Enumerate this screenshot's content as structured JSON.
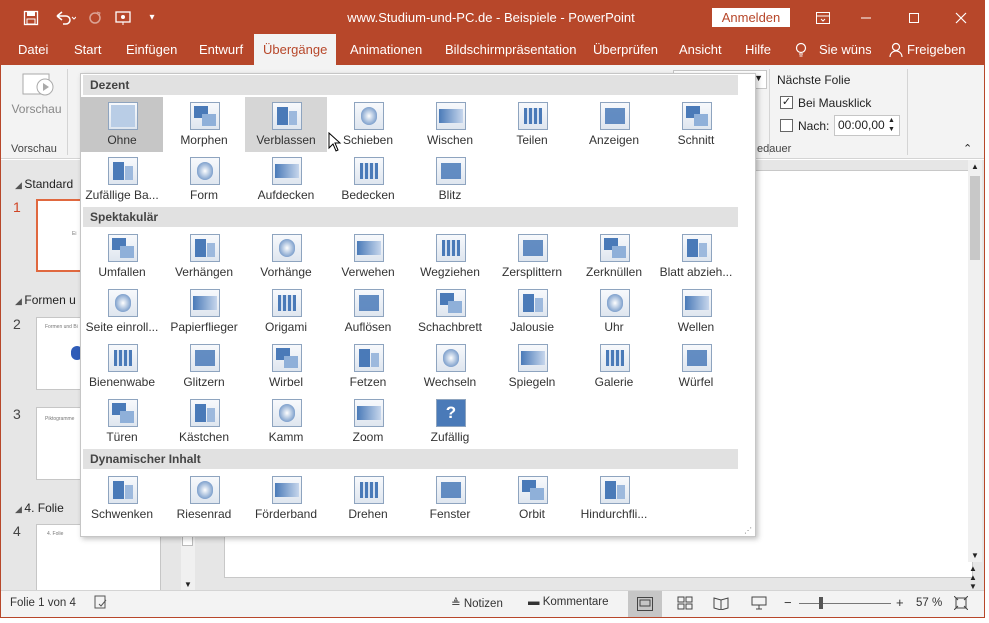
{
  "title": {
    "doc": "www.Studium-und-PC.de - Beispiele - PowerPoint",
    "signin": "Anmelden"
  },
  "tabs": [
    "Datei",
    "Start",
    "Einfügen",
    "Entwurf",
    "Übergänge",
    "Animationen",
    "Bildschirmpräsentation",
    "Überprüfen",
    "Ansicht",
    "Hilfe"
  ],
  "tellme": "Sie wünsc",
  "share": "Freigeben",
  "ribbon": {
    "preview": "Vorschau",
    "preview_group": "Vorschau",
    "next_slide": "Nächste Folie",
    "on_click": "Bei Mausklick",
    "after": "Nach:",
    "after_value": "00:00,00",
    "duration_frag": "edauer"
  },
  "slides_pane": {
    "sections": [
      "Standard",
      "Formen u",
      "4. Folie"
    ],
    "numbers": [
      "1",
      "2",
      "3",
      "4"
    ],
    "thumb_texts": [
      "Formen und Bi",
      "Piktogramme",
      "4. Folie"
    ]
  },
  "gallery": {
    "groups": [
      {
        "title": "Dezent",
        "items": [
          "Ohne",
          "Morphen",
          "Verblassen",
          "Schieben",
          "Wischen",
          "Teilen",
          "Anzeigen",
          "Schnitt",
          "Zufällige Ba...",
          "Form",
          "Aufdecken",
          "Bedecken",
          "Blitz"
        ]
      },
      {
        "title": "Spektakulär",
        "items": [
          "Umfallen",
          "Verhängen",
          "Vorhänge",
          "Verwehen",
          "Wegziehen",
          "Zersplittern",
          "Zerknüllen",
          "Blatt abzieh...",
          "Seite einroll...",
          "Papierflieger",
          "Origami",
          "Auflösen",
          "Schachbrett",
          "Jalousie",
          "Uhr",
          "Wellen",
          "Bienenwabe",
          "Glitzern",
          "Wirbel",
          "Fetzen",
          "Wechseln",
          "Spiegeln",
          "Galerie",
          "Würfel",
          "Türen",
          "Kästchen",
          "Kamm",
          "Zoom",
          "Zufällig"
        ]
      },
      {
        "title": "Dynamischer Inhalt",
        "items": [
          "Schwenken",
          "Riesenrad",
          "Förderband",
          "Drehen",
          "Fenster",
          "Orbit",
          "Hindurchfli..."
        ]
      }
    ],
    "selected": "Ohne",
    "hovered": "Verblassen"
  },
  "status": {
    "slide": "Folie 1 von 4",
    "notes": "Notizen",
    "comments": "Kommentare",
    "zoom": "57 %"
  },
  "colors": {
    "accent": "#b7472a",
    "icon_blue": "#4a7ab8"
  }
}
